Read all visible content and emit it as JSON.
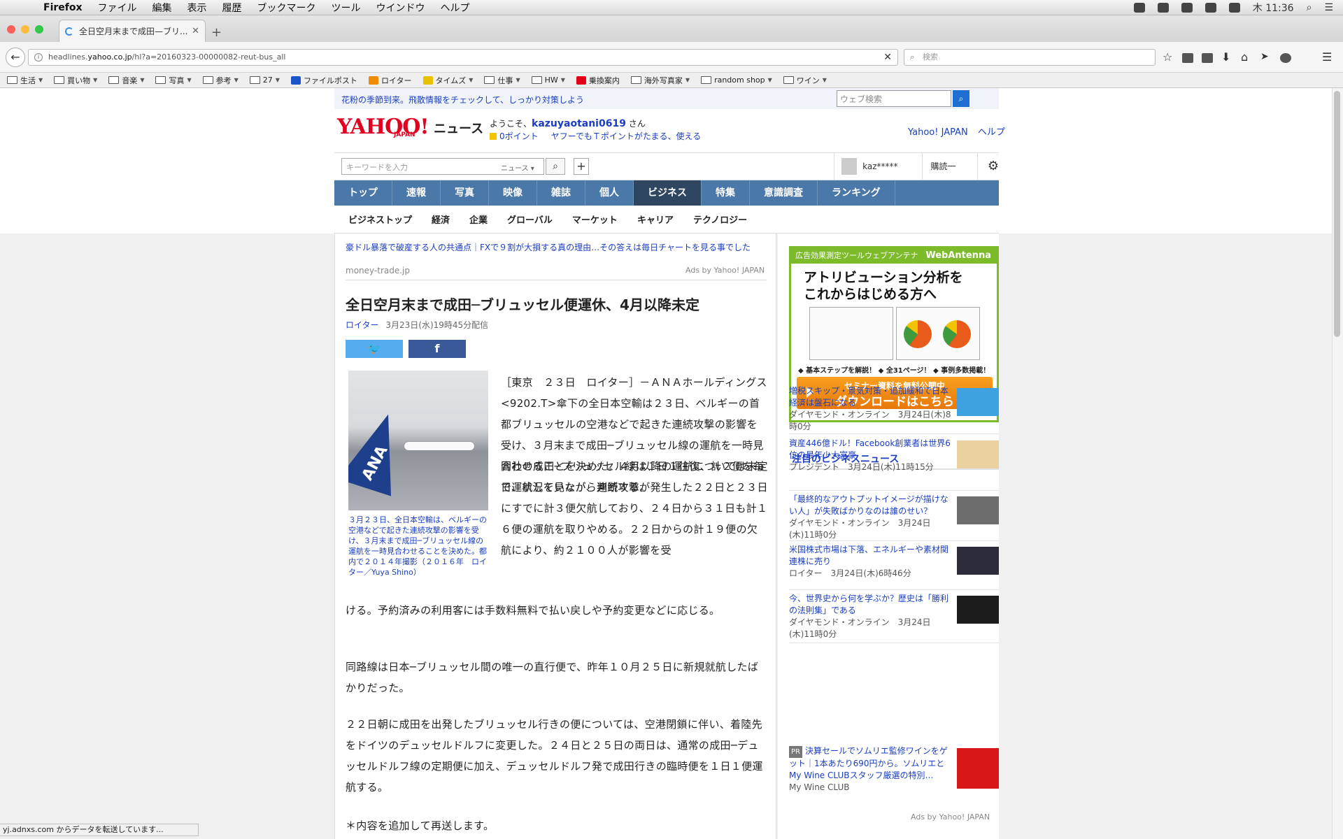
{
  "menubar": {
    "app": "Firefox",
    "items": [
      "ファイル",
      "編集",
      "表示",
      "履歴",
      "ブックマーク",
      "ツール",
      "ウインドウ",
      "ヘルプ"
    ],
    "clock": "木 11:36"
  },
  "browser": {
    "tab_title": "全日空月末まで成田—ブリ...",
    "url_prefix": "headlines.",
    "url_domain": "yahoo.co.jp",
    "url_path": "/hl?a=20160323-00000082-reut-bus_all",
    "search_placeholder": "検索",
    "bookmarks": [
      {
        "label": "生活",
        "menu": true
      },
      {
        "label": "買い物",
        "menu": true
      },
      {
        "label": "音楽",
        "menu": true
      },
      {
        "label": "写真",
        "menu": true
      },
      {
        "label": "参考",
        "menu": true
      },
      {
        "label": "27",
        "menu": true
      },
      {
        "label": "ファイルポスト",
        "menu": false
      },
      {
        "label": "ロイター",
        "menu": false
      },
      {
        "label": "タイムズ",
        "menu": true
      },
      {
        "label": "仕事",
        "menu": true
      },
      {
        "label": "HW",
        "menu": true
      },
      {
        "label": "乗換案内",
        "menu": false
      },
      {
        "label": "海外写真家",
        "menu": true
      },
      {
        "label": "random shop",
        "menu": true
      },
      {
        "label": "ワイン",
        "menu": true
      }
    ],
    "status": "yj.adnxs.com からデータを転送しています..."
  },
  "header": {
    "promo": "花粉の季節到来。飛散情報をチェックして、しっかり対策しよう",
    "websearch_placeholder": "ウェブ検索",
    "logo": "YAHOO!",
    "logo_sub": "JAPAN",
    "section": "ニュース",
    "welcome_prefix": "ようこそ、",
    "username": "kazuyaotani0619",
    "welcome_suffix": " さん",
    "points": "0ポイント",
    "points_msg": "ヤフーでもＴポイントがたまる、使える",
    "link_yj": "Yahoo! JAPAN",
    "link_help": "ヘルプ",
    "keyword_placeholder": "キーワードを入力",
    "keyword_category": "ニュース",
    "user_short": "kaz*****",
    "subscriptions": "購読一覧"
  },
  "nav": {
    "main": [
      "トップ",
      "速報",
      "写真",
      "映像",
      "雑誌",
      "個人",
      "ビジネス",
      "特集",
      "意識調査",
      "ランキング"
    ],
    "active": "ビジネス",
    "sub": [
      "ビジネストップ",
      "経済",
      "企業",
      "グローバル",
      "マーケット",
      "キャリア",
      "テクノロジー"
    ]
  },
  "ad_top": {
    "text": "豪ドル暴落で破産する人の共通点｜FXで９割が大損する真の理由…その答えは毎日チャートを見る事でした",
    "source": "money-trade.jp",
    "by": "Ads by Yahoo! JAPAN"
  },
  "article": {
    "title": "全日空月末まで成田─ブリュッセル便運休、4月以降未定",
    "source": "ロイター",
    "date": "3月23日(水)19時45分配信",
    "photo_text": "ANA",
    "caption": "３月２３日、全日本空輸は、ベルギーの空港などで起きた連続攻撃の影響を受け、３月末まで成田─ブリュッセル線の運航を一時見合わせることを決めた。都内で２０１４年撮影（２０１６年　ロイター／Yuya Shino）",
    "p1": "［東京　２３日　ロイター］－ＡＮＡホールディングス<9202.T>傘下の全日本空輸は２３日、ベルギーの首都ブリュッセルの空港などで起きた連続攻撃の影響を受け、３月末まで成田─ブリュッセル線の運航を一時見合わせることを決めた。４月以降の運航については未定で、状況を見ながら判断する。",
    "p2": "同社の成田─ブリュッセル線は１日１往復、計２便を毎日運航していたが、連続攻撃が発生した２２日と２３日にすでに計３便欠航しており、２４日から３１日も計１６便の運航を取りやめる。２２日からの計１９便の欠航により、約２１００人が影響を受",
    "p2b": "ける。予約済みの利用客には手数料無料で払い戻しや予約変更などに応じる。",
    "p3": "同路線は日本─ブリュッセル間の唯一の直行便で、昨年１０月２５日に新規就航したばかりだった。",
    "p4": "２２日朝に成田を出発したブリュッセル行きの便については、空港閉鎖に伴い、着陸先をドイツのデュッセルドルフに変更した。２４日と２５日の両日は、通常の成田─デュッセルドルフ線の定期便に加え、デュッセルドルフ発で成田行きの臨時便を１日１便運航する。",
    "p5": "＊内容を追加して再送します。"
  },
  "side_ad": {
    "header": "広告効果測定ツールウェブアンテナ",
    "brand": "WebAntenna",
    "headline1": "アトリビューション分析を",
    "headline2": "これからはじめる方へ",
    "steps": "◆ 基本ステップを解説！ ◆ 全31ページ！ ◆ 事例多数掲載！",
    "btn1": "セミナー資料を無料公開中",
    "btn2": "ダウンロードはこちら"
  },
  "side_news": {
    "title": "注目のビジネスニュース",
    "items": [
      {
        "title": "増税スキップ・景気対策・追加緩和で日本経済は盤石になる",
        "meta": "ダイヤモンド・オンライン　3月24日(木)8時0分"
      },
      {
        "title": "資産446億ドル！Facebook創業者は世界6位の最年少大富豪",
        "meta": "プレジデント　3月24日(木)11時15分"
      },
      {
        "title": "「最終的なアウトプットイメージが描けない人」が失敗ばかりなのは誰のせい？",
        "meta": "ダイヤモンド・オンライン　3月24日(木)11時0分"
      },
      {
        "title": "米国株式市場は下落、エネルギーや素材関連株に売り",
        "meta": "ロイター　3月24日(木)6時46分"
      },
      {
        "title": "今、世界史から何を学ぶか？歴史は「勝利の法則集」である",
        "meta": "ダイヤモンド・オンライン　3月24日(木)11時0分"
      }
    ],
    "pr_tag": "PR",
    "pr_title": "決算セールでソムリエ監修ワインをゲット｜1本あたり690円から。ソムリエとMy Wine CLUBスタッフ厳選の特別…",
    "pr_source": "My Wine CLUB",
    "ads_by": "Ads by Yahoo! JAPAN"
  }
}
